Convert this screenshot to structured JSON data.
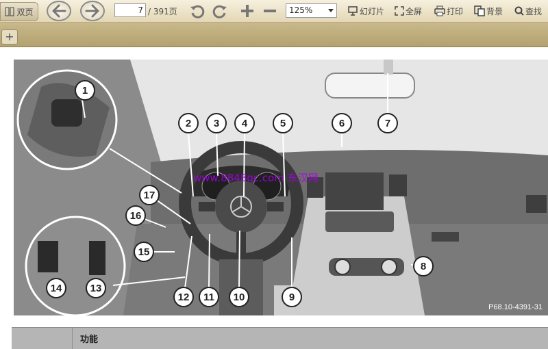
{
  "toolbar": {
    "dual_page_label": "双页",
    "current_page": "7",
    "total_pages": "/ 391页",
    "zoom": "125%",
    "slideshow_label": "幻灯片",
    "fullscreen_label": "全屏",
    "print_label": "打印",
    "background_label": "背景",
    "search_label": "查找"
  },
  "tabbar": {
    "add_label": "+"
  },
  "figure": {
    "caption": "P68.10-4391-31",
    "watermark": "www.8848qc.com  东汉网",
    "callouts": [
      "1",
      "2",
      "3",
      "4",
      "5",
      "6",
      "7",
      "8",
      "9",
      "10",
      "11",
      "12",
      "13",
      "14",
      "15",
      "16",
      "17"
    ]
  },
  "table": {
    "header_function": "功能"
  }
}
